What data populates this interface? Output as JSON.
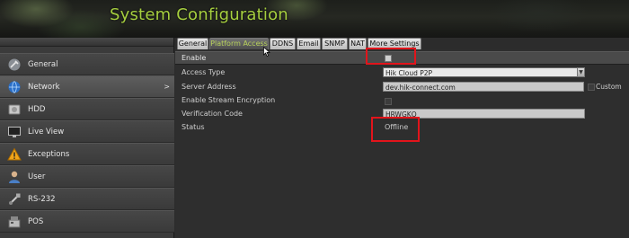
{
  "header": {
    "title": "System Configuration"
  },
  "sidebar": {
    "items": [
      {
        "label": "General",
        "icon": "wrench-icon"
      },
      {
        "label": "Network",
        "icon": "globe-icon",
        "active": true
      },
      {
        "label": "HDD",
        "icon": "hdd-icon"
      },
      {
        "label": "Live View",
        "icon": "monitor-icon"
      },
      {
        "label": "Exceptions",
        "icon": "warning-icon"
      },
      {
        "label": "User",
        "icon": "user-icon"
      },
      {
        "label": "RS-232",
        "icon": "serial-port-icon"
      },
      {
        "label": "POS",
        "icon": "pos-terminal-icon"
      }
    ],
    "active_arrow": ">"
  },
  "tabs": [
    {
      "label": "General"
    },
    {
      "label": "Platform Access",
      "active": true
    },
    {
      "label": "DDNS"
    },
    {
      "label": "Email"
    },
    {
      "label": "SNMP"
    },
    {
      "label": "NAT"
    },
    {
      "label": "More Settings"
    }
  ],
  "form": {
    "enable_label": "Enable",
    "enable_checked": false,
    "access_type_label": "Access Type",
    "access_type_value": "Hik Cloud P2P",
    "server_address_label": "Server Address",
    "server_address_value": "dev.hik-connect.com",
    "custom_label": "Custom",
    "stream_encryption_label": "Enable Stream Encryption",
    "verification_code_label": "Verification Code",
    "verification_code_value": "HRWGKQ",
    "status_label": "Status",
    "status_value": "Offline"
  },
  "colors": {
    "title": "#a6cf3f",
    "active_tab_text": "#b9d35c",
    "highlight_box": "#e2141b"
  }
}
